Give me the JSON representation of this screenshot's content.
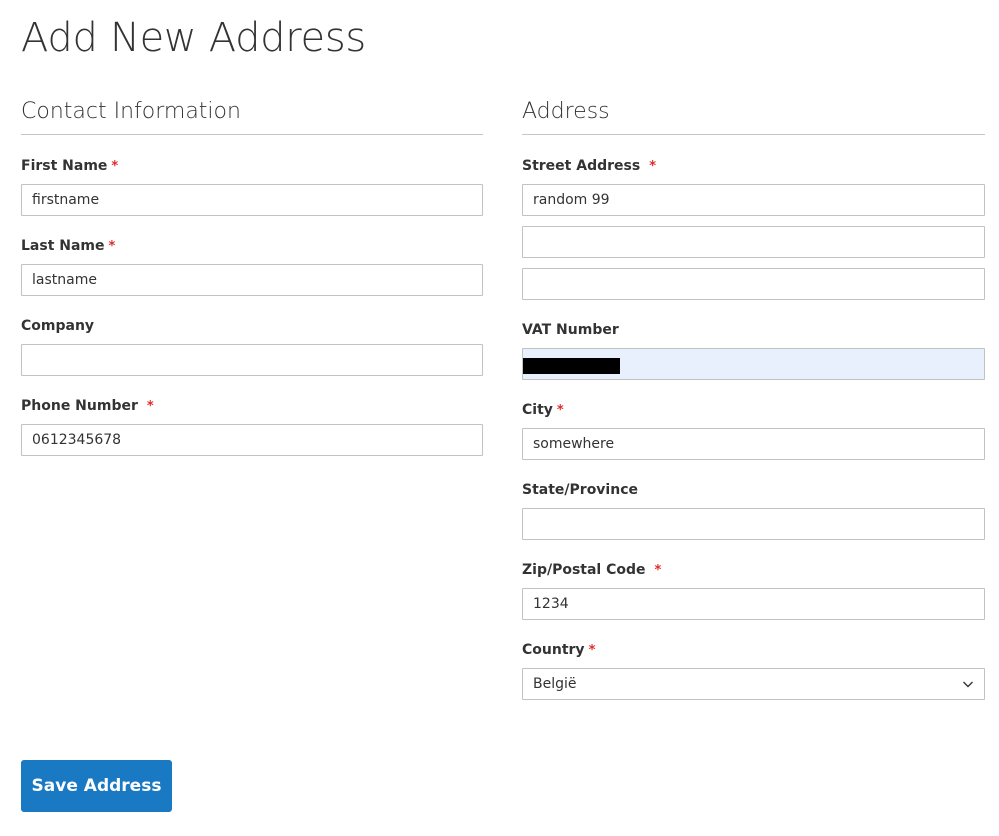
{
  "page": {
    "title": "Add New Address"
  },
  "contact": {
    "legend": "Contact Information",
    "first_name": {
      "label": "First Name",
      "required": "*",
      "value": "firstname"
    },
    "last_name": {
      "label": "Last Name",
      "required": "*",
      "value": "lastname"
    },
    "company": {
      "label": "Company",
      "value": ""
    },
    "phone": {
      "label": "Phone Number",
      "required": "*",
      "value": "0612345678"
    }
  },
  "address": {
    "legend": "Address",
    "street": {
      "label": "Street Address",
      "required": "*",
      "line1": "random 99",
      "line2": "",
      "line3": ""
    },
    "vat": {
      "label": "VAT Number",
      "value": "",
      "state": "autofilled-redacted"
    },
    "city": {
      "label": "City",
      "required": "*",
      "value": "somewhere"
    },
    "state_province": {
      "label": "State/Province",
      "value": ""
    },
    "zip": {
      "label": "Zip/Postal Code",
      "required": "*",
      "value": "1234"
    },
    "country": {
      "label": "Country",
      "required": "*",
      "selected": "België"
    }
  },
  "actions": {
    "save_label": "Save Address"
  },
  "colors": {
    "primary": "#1979c3",
    "required": "#e02b27",
    "autofill": "#e8f0fe"
  },
  "icons": {
    "country_dropdown": "chevron-down-icon"
  }
}
